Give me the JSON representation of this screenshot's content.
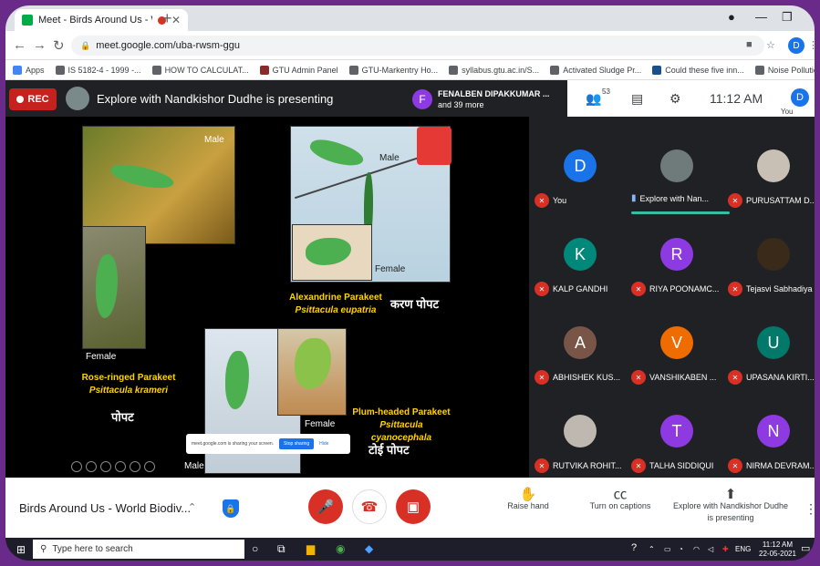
{
  "browser": {
    "tab_title": "Meet - Birds Around Us - Wo",
    "url": "meet.google.com/uba-rwsm-ggu",
    "profile_initial": "D"
  },
  "bookmarks": [
    "Apps",
    "IS 5182-4 - 1999 -...",
    "HOW TO CALCULAT...",
    "GTU Admin Panel",
    "GTU-Markentry Ho...",
    "syllabus.gtu.ac.in/S...",
    "Activated Sludge Pr...",
    "Could these five inn...",
    "Noise Pollution —..."
  ],
  "meet_top": {
    "rec_label": "REC",
    "presenting_text": "Explore with Nandkishor Dudhe is presenting",
    "participant_initial": "F",
    "participant_name": "FENALBEN DIPAKKUMAR ...",
    "participant_more": "and 39 more",
    "people_count": "53",
    "time": "11:12 AM",
    "you_label": "You",
    "you_initial": "D"
  },
  "slide": {
    "label_male_1": "Male",
    "label_female_1": "Female",
    "rose_name": "Rose-ringed Parakeet",
    "rose_sci": "Psittacula krameri",
    "rose_local": "पोपट",
    "label_male_2": "Male",
    "label_female_2": "Female",
    "alex_name": "Alexandrine Parakeet",
    "alex_sci": "Psittacula eupatria",
    "alex_local": "करण पोपट",
    "label_female_3": "Female",
    "label_male_3": "Male",
    "plum_name": "Plum-headed Parakeet",
    "plum_sci": "Psittacula cyanocephala",
    "plum_local": "टोई पोपट",
    "share_text": "meet.google.com is sharing your screen.",
    "share_stop": "Stop sharing",
    "share_hide": "Hide"
  },
  "participants": [
    {
      "initial": "D",
      "name": "You",
      "color": "#1a73e8",
      "state": "muted"
    },
    {
      "initial": "",
      "name": "Explore with Nan...",
      "color": "#6f7b7b",
      "state": "speaking"
    },
    {
      "initial": "",
      "name": "PURUSATTAM D...",
      "color": "#c9c0b5",
      "state": "muted"
    },
    {
      "initial": "K",
      "name": "KALP GANDHI",
      "color": "#00897b",
      "state": "muted"
    },
    {
      "initial": "R",
      "name": "RIYA POONAMC...",
      "color": "#8e3ae2",
      "state": "muted"
    },
    {
      "initial": "",
      "name": "Tejasvi Sabhadiya",
      "color": "#3a2a1a",
      "state": "muted"
    },
    {
      "initial": "A",
      "name": "ABHISHEK KUS...",
      "color": "#795548",
      "state": "muted"
    },
    {
      "initial": "V",
      "name": "VANSHIKABEN ...",
      "color": "#ef6c00",
      "state": "muted"
    },
    {
      "initial": "U",
      "name": "UPASANA KIRTI...",
      "color": "#00796b",
      "state": "muted"
    },
    {
      "initial": "",
      "name": "RUTVIKA ROHIT...",
      "color": "#bfb8b0",
      "state": "muted"
    },
    {
      "initial": "T",
      "name": "TALHA SIDDIQUI",
      "color": "#8e3ae2",
      "state": "muted"
    },
    {
      "initial": "N",
      "name": "NIRMA DEVRAM...",
      "color": "#8e3ae2",
      "state": "muted"
    }
  ],
  "bottom": {
    "meeting_name": "Birds Around Us - World Biodiv...",
    "raise_hand": "Raise hand",
    "captions": "Turn on captions",
    "presenting": "Explore with Nandkishor Dudhe is presenting"
  },
  "taskbar": {
    "search_placeholder": "Type here to search",
    "lang": "ENG",
    "time": "11:12 AM",
    "date": "22-05-2021"
  }
}
